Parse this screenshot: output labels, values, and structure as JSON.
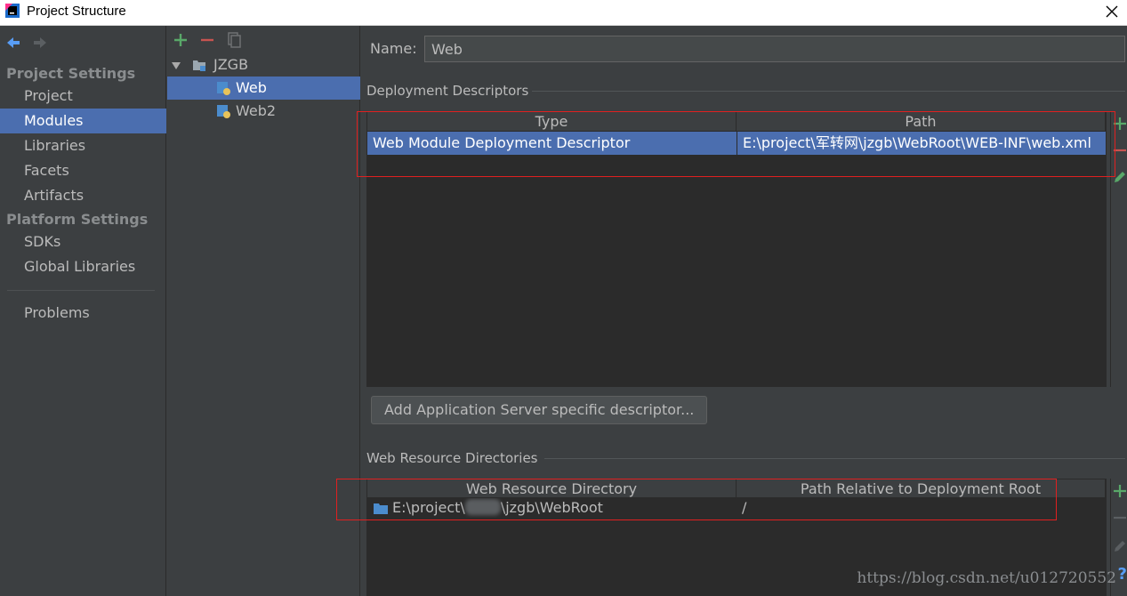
{
  "window": {
    "title": "Project Structure"
  },
  "nav": {
    "project_settings_header": "Project Settings",
    "project_settings_items": [
      "Project",
      "Modules",
      "Libraries",
      "Facets",
      "Artifacts"
    ],
    "platform_settings_header": "Platform Settings",
    "platform_settings_items": [
      "SDKs",
      "Global Libraries"
    ],
    "problems": "Problems",
    "selected": "Modules"
  },
  "tree": {
    "root": "JZGB",
    "children": [
      "Web",
      "Web2"
    ],
    "selected": "Web"
  },
  "main": {
    "name_label": "Name:",
    "name_value": "Web",
    "deployment_descriptors": {
      "title": "Deployment Descriptors",
      "columns": [
        "Type",
        "Path"
      ],
      "rows": [
        {
          "type": "Web Module Deployment Descriptor",
          "path": "E:\\project\\军转网\\jzgb\\WebRoot\\WEB-INF\\web.xml"
        }
      ]
    },
    "add_server_button": "Add Application Server specific descriptor...",
    "web_resource_directories": {
      "title": "Web Resource Directories",
      "columns": [
        "Web Resource Directory",
        "Path Relative to Deployment Root"
      ],
      "rows": [
        {
          "dir_prefix": "E:\\project\\",
          "dir_suffix": "\\jzgb\\WebRoot",
          "relative": "/"
        }
      ]
    }
  },
  "watermark": "https://blog.csdn.net/u012720552",
  "help": "?",
  "colors": {
    "selection": "#4b6eaf",
    "add": "#59a869",
    "remove": "#c75450",
    "highlight_box": "#e02020"
  }
}
